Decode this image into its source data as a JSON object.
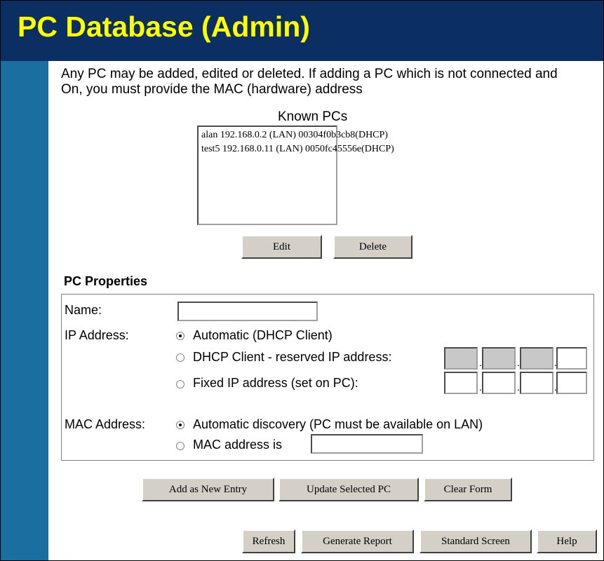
{
  "header": {
    "title": "PC Database (Admin)"
  },
  "intro": {
    "text": "Any PC may be added, edited or deleted. If adding a PC which is not connected and On, you must provide the MAC (hardware) address"
  },
  "known_pcs": {
    "label": "Known PCs",
    "entries": [
      "alan 192.168.0.2 (LAN) 00304f0b3cb8(DHCP)",
      "test5 192.168.0.11 (LAN) 0050fc45556e(DHCP)"
    ],
    "edit_label": "Edit",
    "delete_label": "Delete"
  },
  "properties": {
    "heading": "PC Properties",
    "name_label": "Name:",
    "name_value": "",
    "ip_label": "IP Address:",
    "ip_options": [
      {
        "label": "Automatic (DHCP Client)",
        "checked": true
      },
      {
        "label": "DHCP Client - reserved IP address:",
        "checked": false
      },
      {
        "label": "Fixed IP address (set on PC):",
        "checked": false
      }
    ],
    "mac_label": "MAC Address:",
    "mac_options": [
      {
        "label": "Automatic discovery (PC must be available on LAN)",
        "checked": true
      },
      {
        "label": "MAC address is",
        "checked": false
      }
    ],
    "mac_value": ""
  },
  "actions": {
    "add_label": "Add as New Entry",
    "update_label": "Update Selected PC",
    "clear_label": "Clear Form"
  },
  "footer": {
    "refresh_label": "Refresh",
    "report_label": "Generate Report",
    "standard_label": "Standard Screen",
    "help_label": "Help"
  },
  "colors": {
    "banner_bg": "#0b2e63",
    "title_color": "#ffff00",
    "sidebar_bg": "#1a6fa0",
    "button_face": "#d4d0c8"
  }
}
